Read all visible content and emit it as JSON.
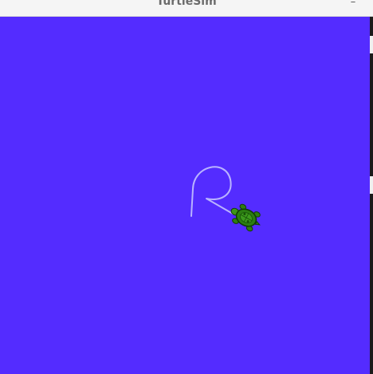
{
  "window": {
    "title": "TurtleSim",
    "minimize_glyph": "–"
  },
  "canvas": {
    "background": "#542cff",
    "pen_color": "#b9b3ff",
    "turtle_icon": "turtle-icon"
  }
}
